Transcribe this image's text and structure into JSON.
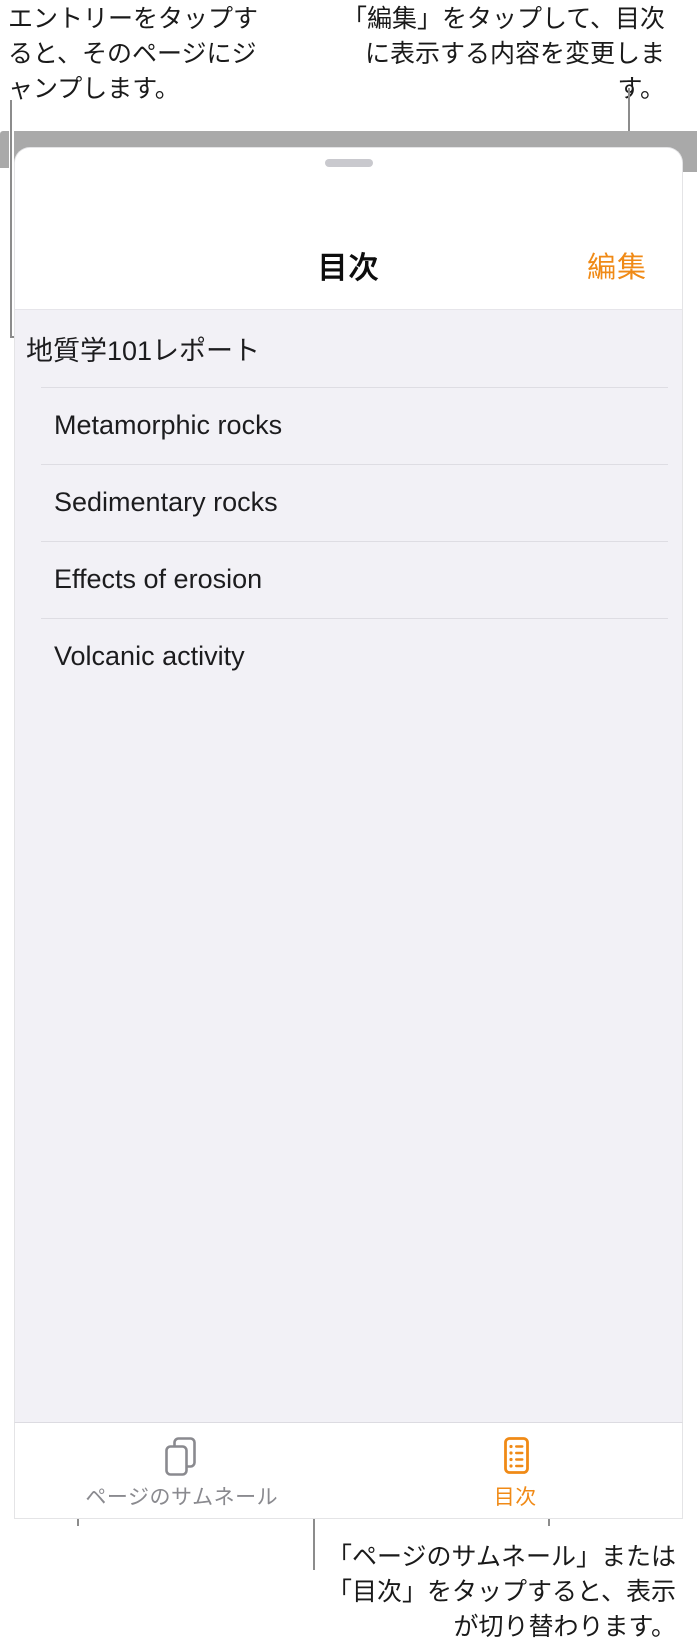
{
  "annotations": {
    "top_left": "エントリーをタップすると、そのページにジャンプします。",
    "top_right": "「編集」をタップして、目次に表示する内容を変更します。",
    "bottom": "「ページのサムネール」または「目次」をタップすると、表示が切り替わります。"
  },
  "sheet": {
    "title": "目次",
    "edit_label": "編集",
    "grab_handle": "grab-handle",
    "toc_entries": [
      {
        "label": "地質学101レポート",
        "level": 0
      },
      {
        "label": "Metamorphic rocks",
        "level": 1
      },
      {
        "label": "Sedimentary rocks",
        "level": 1
      },
      {
        "label": "Effects of erosion",
        "level": 1
      },
      {
        "label": "Volcanic activity",
        "level": 1
      }
    ]
  },
  "tab_bar": {
    "tabs": [
      {
        "label": "ページのサムネール",
        "icon": "page-thumbnails-icon",
        "active": false
      },
      {
        "label": "目次",
        "icon": "table-of-contents-icon",
        "active": true
      }
    ]
  },
  "colors": {
    "accent_orange": "#f08a16",
    "list_background": "#f2f1f6",
    "toolbar_grey": "#a9a9a9",
    "inactive_grey": "#8a8a8f",
    "leader_line": "#8c8c8c",
    "divider": "#dedde3",
    "text_primary": "#1c1c1e"
  }
}
